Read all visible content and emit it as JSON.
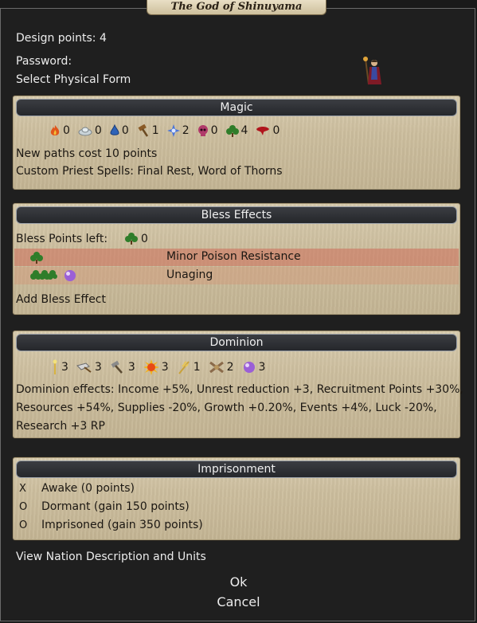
{
  "title": "The God of Shinuyama",
  "design_points": "Design points: 4",
  "password_label": "Password:",
  "select_form": "Select Physical Form",
  "magic": {
    "header": "Magic",
    "paths": [
      {
        "icon": "fire-icon",
        "value": "0",
        "color": "#e0561c"
      },
      {
        "icon": "air-icon",
        "value": "0",
        "color": "#c9d3d8"
      },
      {
        "icon": "water-icon",
        "value": "0",
        "color": "#2e63b8"
      },
      {
        "icon": "earth-icon",
        "value": "1",
        "color": "#8a5a26"
      },
      {
        "icon": "astral-icon",
        "value": "2",
        "color": "#4a74d8"
      },
      {
        "icon": "death-icon",
        "value": "0",
        "color": "#b03a6a"
      },
      {
        "icon": "nature-icon",
        "value": "4",
        "color": "#2f7d2a"
      },
      {
        "icon": "blood-icon",
        "value": "0",
        "color": "#b0141c"
      }
    ],
    "cost_text": "New paths cost 10 points",
    "spells_text": "Custom Priest Spells: Final Rest, Word of Thorns"
  },
  "bless": {
    "header": "Bless Effects",
    "points_label": "Bless Points left:",
    "points_value": "0",
    "effects": [
      {
        "name": "Minor Poison Resistance"
      },
      {
        "name": "Unaging"
      }
    ],
    "add_label": "Add Bless Effect"
  },
  "dominion": {
    "header": "Dominion",
    "scales": [
      {
        "icon": "order-icon",
        "value": "3"
      },
      {
        "icon": "productivity-icon",
        "value": "3"
      },
      {
        "icon": "heat-icon",
        "value": "3"
      },
      {
        "icon": "growth-icon",
        "value": "3"
      },
      {
        "icon": "fortune-icon",
        "value": "1"
      },
      {
        "icon": "turmoil-icon",
        "value": "2"
      },
      {
        "icon": "magic-icon",
        "value": "3"
      }
    ],
    "effects_line1": "Dominion effects: Income +5%, Unrest reduction +3, Recruitment Points +30%,",
    "effects_line2": "Resources +54%, Supplies -20%, Growth +0.20%, Events +4%, Luck -20%,",
    "effects_line3": "Research +3 RP"
  },
  "imprisonment": {
    "header": "Imprisonment",
    "options": [
      {
        "mark": "X",
        "label": "Awake (0 points)"
      },
      {
        "mark": "O",
        "label": "Dormant (gain 150 points)"
      },
      {
        "mark": "O",
        "label": "Imprisoned (gain 350 points)"
      }
    ]
  },
  "view_nation": "View Nation Description and Units",
  "ok_label": "Ok",
  "cancel_label": "Cancel"
}
